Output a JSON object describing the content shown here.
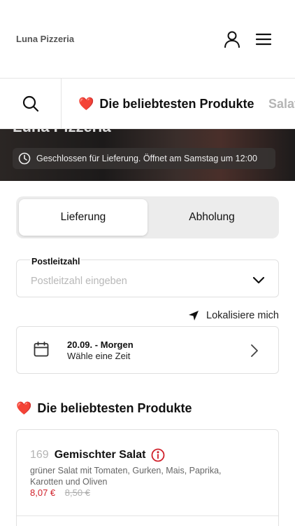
{
  "header": {
    "brand": "Luna Pizzeria",
    "user_icon": "user-icon",
    "menu_icon": "hamburger-menu-icon"
  },
  "categories": {
    "search_icon": "search-icon",
    "items": [
      {
        "emoji": "❤️",
        "label": "Die beliebtesten Produkte",
        "active": true
      },
      {
        "label": "Salat",
        "active": false
      }
    ]
  },
  "banner": {
    "title": "Luna Pizzeria",
    "status_text": "Geschlossen für Lieferung. Öffnet am Samstag um 12:00"
  },
  "order_mode": {
    "options": [
      "Lieferung",
      "Abholung"
    ],
    "selected": "Lieferung"
  },
  "postal_code": {
    "label": "Postleitzahl",
    "placeholder": "Postleitzahl eingeben",
    "value": ""
  },
  "locate": {
    "label": "Lokalisiere mich"
  },
  "date_picker": {
    "date": "20.09. - Morgen",
    "subtitle": "Wähle eine Zeit"
  },
  "section": {
    "emoji": "❤️",
    "title": "Die beliebtesten Produkte"
  },
  "products": [
    {
      "number": "169",
      "name": "Gemischter Salat",
      "description": "grüner Salat mit Tomaten, Gurken, Mais, Paprika, Karotten und Oliven",
      "price": "8,07 €",
      "old_price": "8,50 €"
    }
  ],
  "colors": {
    "accent_red": "#d0202a",
    "muted_gray": "#b5b5b5",
    "toggle_bg": "#ececec"
  }
}
